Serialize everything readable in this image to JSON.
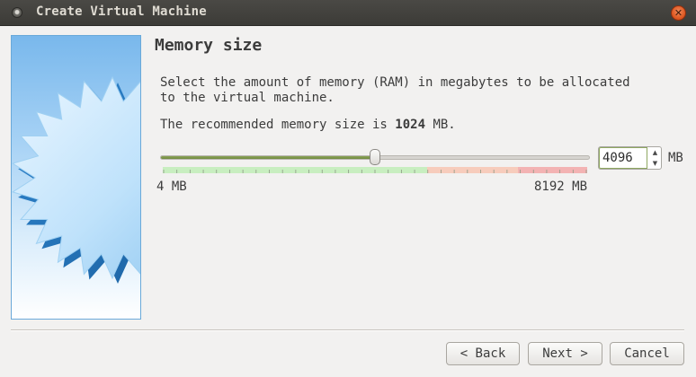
{
  "window": {
    "title": "Create Virtual Machine",
    "close_icon": "close-icon"
  },
  "banner": {
    "icon": "starburst-badge"
  },
  "page": {
    "heading": "Memory size",
    "description": "Select the amount of memory (RAM) in megabytes to be allocated\nto the virtual machine.",
    "recommend_prefix": "The recommended memory size is ",
    "recommend_value": "1024",
    "recommend_suffix": " MB."
  },
  "memory": {
    "value": "4096",
    "unit": "MB",
    "min_label": "4 MB",
    "max_label": "8192 MB",
    "slider_fraction": 0.5
  },
  "colors": {
    "slider_fill": "#7a9548",
    "zone_green": "#c8eec0",
    "zone_orange": "#f7ccbc",
    "zone_red": "#f3b3b3",
    "accent_close": "#e05a23"
  },
  "buttons": {
    "back": "< Back",
    "next": "Next >",
    "cancel": "Cancel"
  }
}
